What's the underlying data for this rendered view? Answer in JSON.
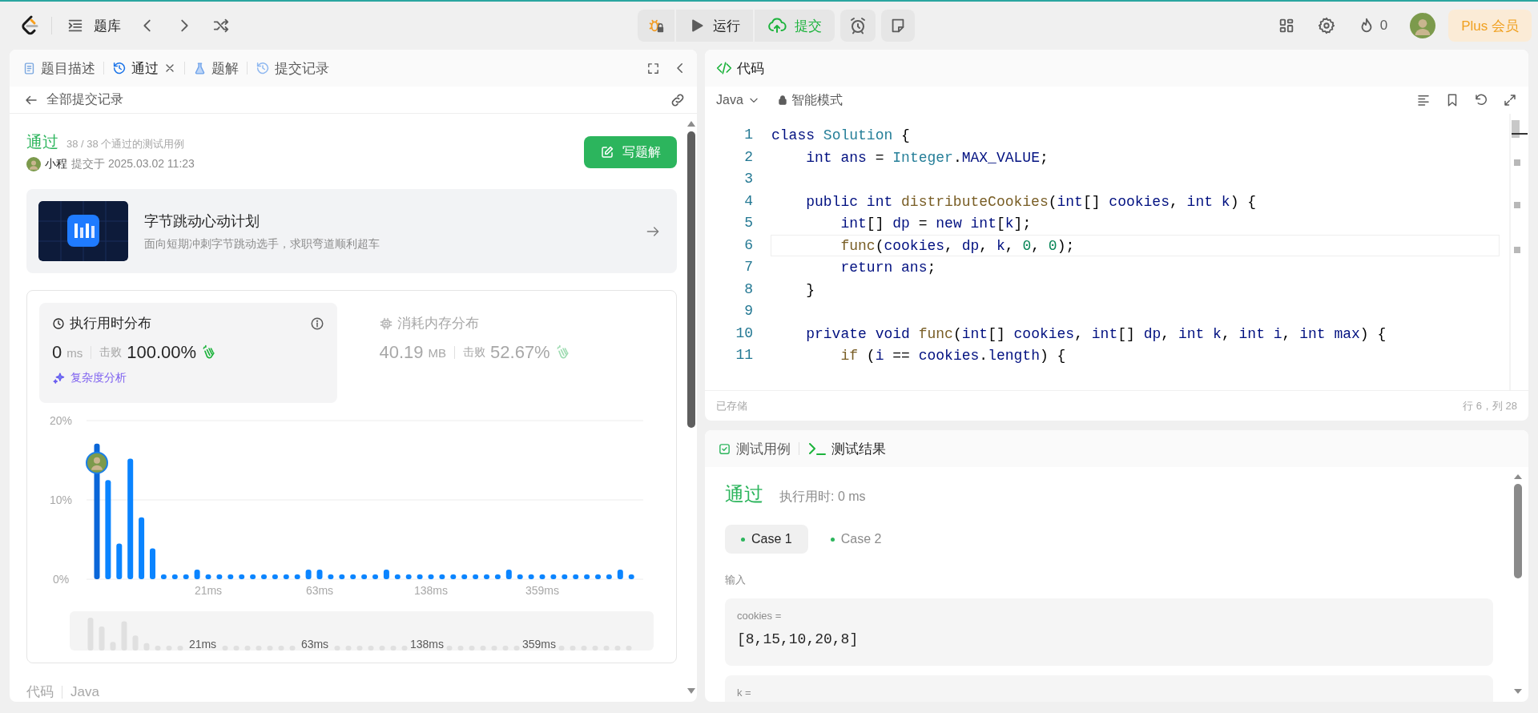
{
  "topbar": {
    "problem_bank": "题库",
    "run": "运行",
    "submit": "提交",
    "streak": "0",
    "plus": "Plus 会员"
  },
  "left_panel": {
    "tabs": [
      {
        "label": "题目描述",
        "kind": "description",
        "selected": false,
        "closable": false
      },
      {
        "label": "通过",
        "kind": "result",
        "selected": true,
        "closable": true
      },
      {
        "label": "题解",
        "kind": "solutions",
        "selected": false,
        "closable": false
      },
      {
        "label": "提交记录",
        "kind": "submissions",
        "selected": false,
        "closable": false
      }
    ],
    "back_link": "全部提交记录",
    "status": "通过",
    "status_detail": "38 / 38 个通过的测试用例",
    "author": "小程",
    "submitted_at": "提交于 2025.03.02 11:23",
    "write_solution": "写题解",
    "banner": {
      "title": "字节跳动心动计划",
      "subtitle": "面向短期冲刺字节跳动选手，求职弯道顺利超车"
    },
    "runtime": {
      "kind": "time",
      "title": "执行用时分布",
      "value": "0",
      "unit": "ms",
      "beats_label": "击败",
      "beats": "100.00%",
      "selected": true,
      "analysis": "复杂度分析"
    },
    "memory": {
      "kind": "memory",
      "title": "消耗内存分布",
      "value": "40.19",
      "unit": "MB",
      "beats_label": "击败",
      "beats": "52.67%",
      "selected": false
    },
    "chart_data": {
      "type": "bar",
      "categories": [
        null,
        null,
        null,
        null,
        null,
        null,
        null,
        null,
        null,
        null,
        "21ms",
        null,
        null,
        null,
        null,
        null,
        null,
        null,
        null,
        null,
        "63ms",
        null,
        null,
        null,
        null,
        null,
        null,
        null,
        null,
        null,
        "138ms",
        null,
        null,
        null,
        null,
        null,
        null,
        null,
        null,
        null,
        "359ms",
        null,
        null,
        null,
        null,
        null,
        null,
        null,
        null
      ],
      "values": [
        17.1,
        12.5,
        4.5,
        15.2,
        7.8,
        3.9,
        0.6,
        0.6,
        0.6,
        1.2,
        0.6,
        0.6,
        0.6,
        0.6,
        0.6,
        0.6,
        0.6,
        0.6,
        0.6,
        1.2,
        1.2,
        0.6,
        0.6,
        0.6,
        0.6,
        0.6,
        1.2,
        0.6,
        0.6,
        0.6,
        0.6,
        0.6,
        0.6,
        0.6,
        0.6,
        0.6,
        0.6,
        1.2,
        0.6,
        0.6,
        0.6,
        0.6,
        0.6,
        0.6,
        0.6,
        0.6,
        0.6,
        1.2,
        0.6
      ],
      "ylim": [
        0,
        20
      ],
      "yticks": [
        {
          "value": 0,
          "label": "0%"
        },
        {
          "value": 10,
          "label": "10%"
        },
        {
          "value": 20,
          "label": "20%"
        }
      ]
    },
    "overview_labels": [
      "21ms",
      "63ms",
      "138ms",
      "359ms"
    ],
    "code_label": "代码",
    "language": "Java"
  },
  "editor": {
    "title": "代码",
    "language": "Java",
    "mode": "智能模式",
    "lines": [
      {
        "n": "1",
        "current": false,
        "text": "class Solution {"
      },
      {
        "n": "2",
        "current": false,
        "text": "    int ans = Integer.MAX_VALUE;"
      },
      {
        "n": "3",
        "current": false
      },
      {
        "n": "4",
        "current": false,
        "text": "    public int distributeCookies(int[] cookies, int k) {"
      },
      {
        "n": "5",
        "current": false,
        "text": "        int[] dp = new int[k];"
      },
      {
        "n": "6",
        "current": true,
        "text": "        func(cookies, dp, k, 0, 0);"
      },
      {
        "n": "7",
        "current": false,
        "text": "        return ans;"
      },
      {
        "n": "8",
        "current": false,
        "text": "    }"
      },
      {
        "n": "9",
        "current": false
      },
      {
        "n": "10",
        "current": false,
        "text": "    private void func(int[] cookies, int[] dp, int k, int i, int max) {"
      },
      {
        "n": "11",
        "current": false,
        "text": "        if (i == cookies.length) {"
      }
    ],
    "saved": "已存储",
    "cursor": "行 6，列 28"
  },
  "result": {
    "tabs": [
      {
        "label": "测试用例",
        "kind": "cases",
        "selected": false
      },
      {
        "label": "测试结果",
        "kind": "result",
        "selected": true
      }
    ],
    "status": "通过",
    "runtime": "执行用时: 0 ms",
    "cases": [
      {
        "label": "Case 1",
        "selected": true,
        "passed": true
      },
      {
        "label": "Case 2",
        "selected": false,
        "passed": true
      }
    ],
    "input_label": "输入",
    "inputs": [
      {
        "name": "cookies =",
        "value": "[8,15,10,20,8]"
      },
      {
        "name": "k ="
      }
    ]
  }
}
